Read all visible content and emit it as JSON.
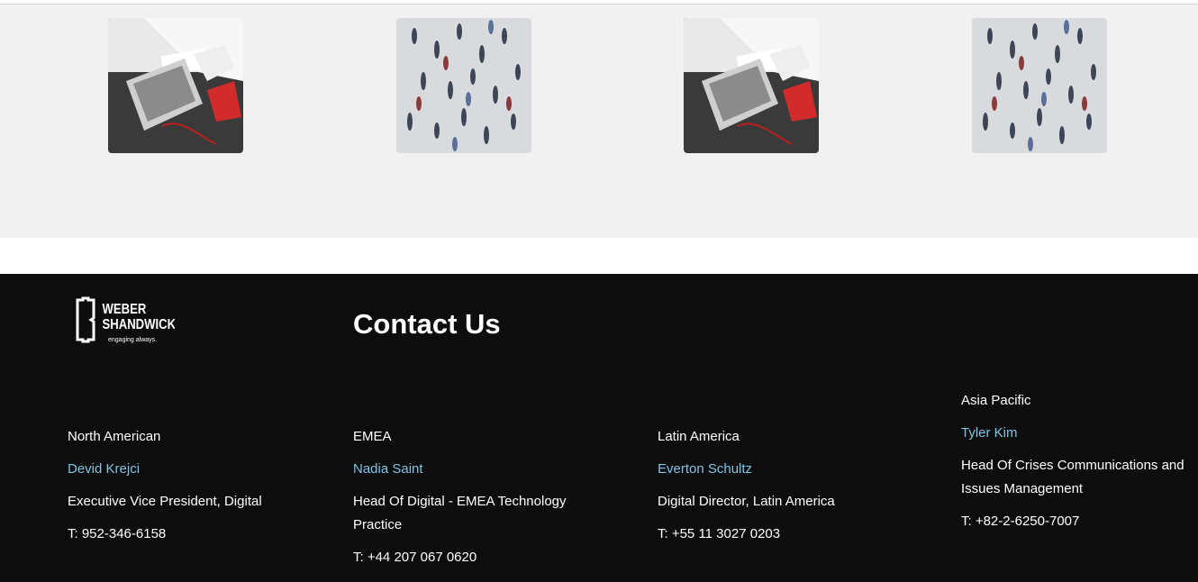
{
  "gallery": {
    "images": [
      {
        "icon": "laptop-desk-photo"
      },
      {
        "icon": "crowd-photo"
      },
      {
        "icon": "laptop-desk-photo"
      },
      {
        "icon": "crowd-photo"
      }
    ]
  },
  "footer": {
    "logo": {
      "line1": "WEBER",
      "line2": "SHANDWICK",
      "tagline": "engaging always."
    },
    "title": "Contact Us",
    "contacts": [
      {
        "region": "North American",
        "name": "Devid Krejci",
        "role_line1": "Executive Vice President, Digital",
        "role_line2": "",
        "phone": "T: 952-346-6158"
      },
      {
        "region": "EMEA",
        "name": "Nadia Saint",
        "role_line1": "Head Of Digital - EMEA Technology",
        "role_line2": "Practice",
        "phone": "T: +44 207 067 0620"
      },
      {
        "region": "Latin America",
        "name": "Everton Schultz",
        "role_line1": "Digital Director, Latin America",
        "role_line2": "",
        "phone": "T: +55 11 3027 0203"
      },
      {
        "region": "Asia Pacific",
        "name": "Tyler Kim",
        "role_line1": "Head Of Crises Communications and",
        "role_line2": "Issues Management",
        "phone": "T: +82-2-6250-7007"
      }
    ]
  },
  "colors": {
    "footer_bg": "#0d0d0d",
    "gallery_bg": "#f1f1f1",
    "link": "#7fc4e6"
  }
}
